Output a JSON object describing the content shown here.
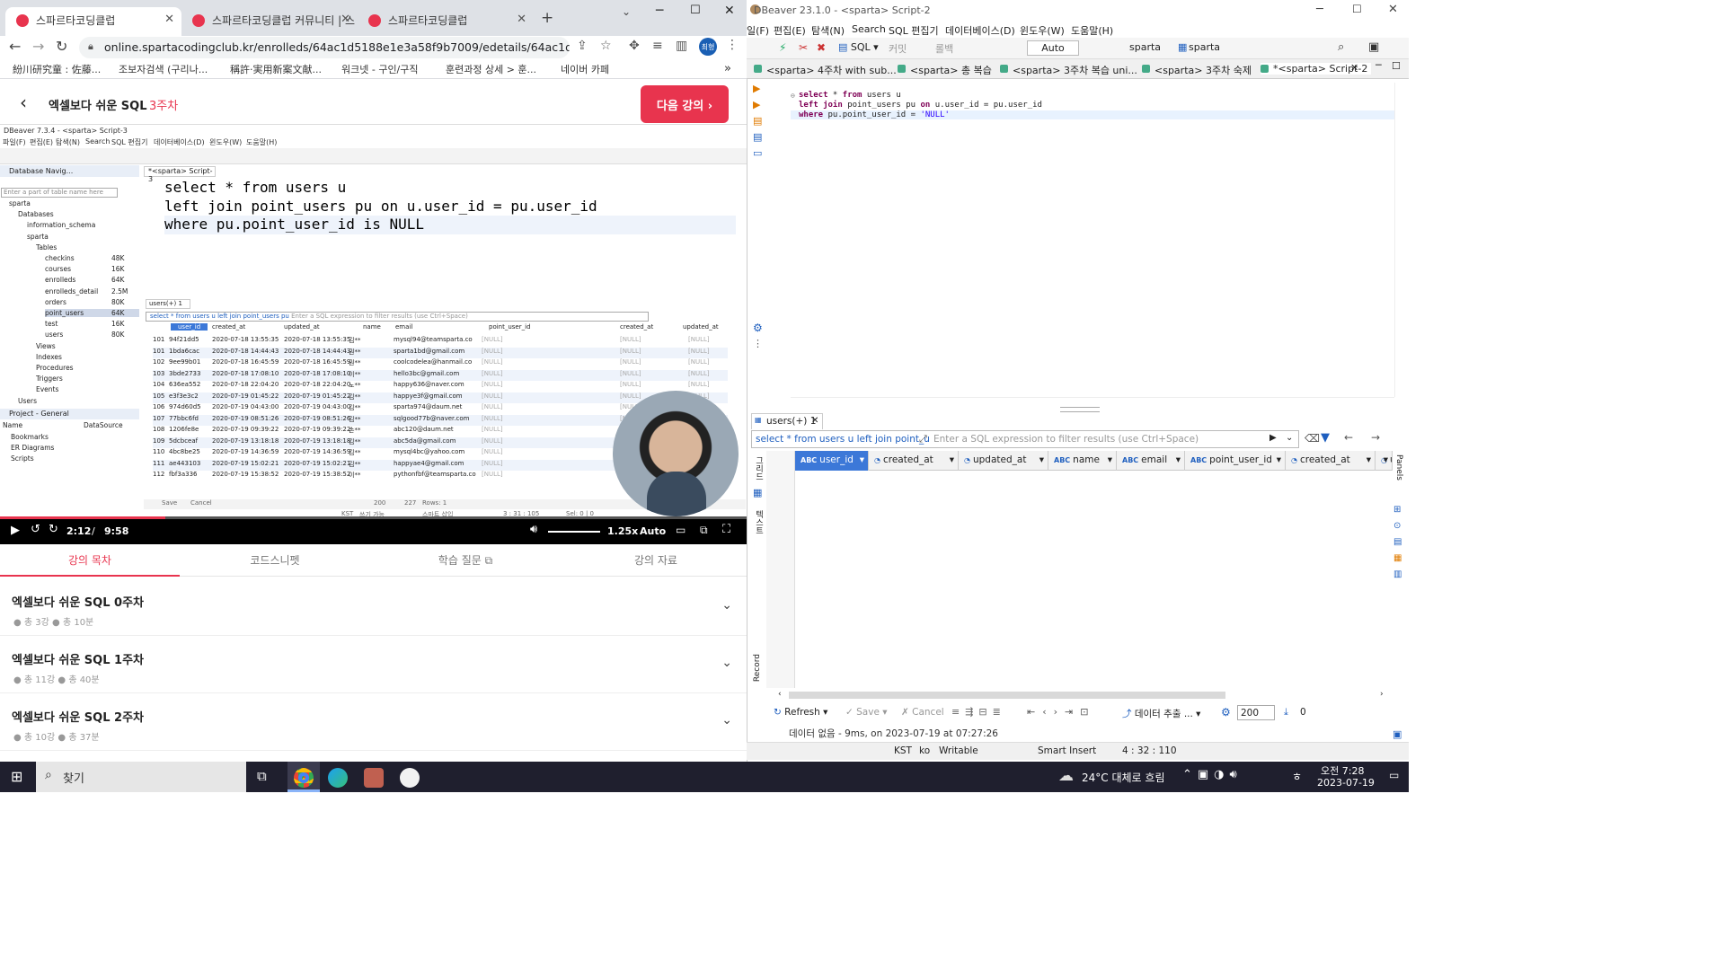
{
  "chrome": {
    "tabs": [
      {
        "title": "스파르타코딩클럽",
        "active": true
      },
      {
        "title": "스파르타코딩클럽 커뮤니티 | 스",
        "active": false
      },
      {
        "title": "스파르타코딩클럽",
        "active": false
      }
    ],
    "url": "online.spartacodingclub.kr/enrolleds/64ac1d5188e1e3a58f9b7009/edetails/64ac1d5188e1e3a58f9...",
    "profile_initials": "최형",
    "bookmarks": [
      "紛川研究童 : 佐藤...",
      "조보자검색 (구리나...",
      "稱許·実用新案文献...",
      "워크넷 - 구인/구직",
      "훈련과정 상세 > 훈...",
      "네이버 카페"
    ]
  },
  "lecture": {
    "title": "엑셀보다 쉬운 SQL",
    "week_label": "3주차",
    "next_button": "다음 강의",
    "tabs": [
      "강의 목차",
      "코드스니펫",
      "학습 질문",
      "강의 자료"
    ],
    "weeks": [
      {
        "title": "엑셀보다 쉬운 SQL 0주차",
        "lessons": "총 3강",
        "time": "총 10분"
      },
      {
        "title": "엑셀보다 쉬운 SQL 1주차",
        "lessons": "총 11강",
        "time": "총 40분"
      },
      {
        "title": "엑셀보다 쉬운 SQL 2주차",
        "lessons": "총 10강",
        "time": "총 37분"
      }
    ]
  },
  "video": {
    "current_time": "2:12",
    "separator": "/",
    "duration": "9:58",
    "progress": 0.221,
    "speed": "1.25x",
    "quality": "Auto",
    "inner": {
      "title": "DBeaver 7.3.4 - <sparta> Script-3",
      "menu": [
        "파일(F)",
        "편집(E)",
        "탐색(N)",
        "Search",
        "SQL 편집기",
        "데이터베이스(D)",
        "윈도우(W)",
        "도움말(H)"
      ],
      "nav_title": "Database Navig...",
      "project_title": "Project - General",
      "script_tab": "*<sparta> Script-3",
      "filter_placeholder": "Enter a part of table name here",
      "tree": [
        "sparta",
        "Databases",
        "information_schema",
        "sparta",
        "Tables",
        "checkins",
        "courses",
        "enrolleds",
        "enrolleds_detail",
        "orders",
        "point_users",
        "test",
        "users",
        "Views",
        "Indexes",
        "Procedures",
        "Triggers",
        "Events",
        "Users"
      ],
      "sizes": [
        "48K",
        "16K",
        "64K",
        "2.5M",
        "80K",
        "64K",
        "16K",
        "80K"
      ],
      "project_cols": [
        "Name",
        "DataSource"
      ],
      "project_items": [
        "Bookmarks",
        "ER Diagrams",
        "Scripts"
      ],
      "sql": [
        "select * from users u",
        "left join point_users pu on u.user_id = pu.user_id",
        "where pu.point_user_id is NULL"
      ],
      "result_tab": "users(+) 1",
      "result_filter": "select * from users u left join point_users pu",
      "result_filter_hint": "Enter a SQL expression to filter results (use Ctrl+Space)",
      "columns": [
        "user_id",
        "created_at",
        "updated_at",
        "name",
        "email",
        "point_user_id",
        "created_at",
        "updated_at"
      ],
      "rows": [
        [
          "101",
          "94f21dd5",
          "2020-07-18 13:55:35",
          "2020-07-18 13:55:35",
          "김**",
          "mysql94@teamsparta.co",
          "[NULL]",
          "[NULL]",
          "[NULL]"
        ],
        [
          "101",
          "1bda6cac",
          "2020-07-18 14:44:43",
          "2020-07-18 14:44:43",
          "권**",
          "sparta1bd@gmail.com",
          "[NULL]",
          "[NULL]",
          "[NULL]"
        ],
        [
          "102",
          "9ee99b01",
          "2020-07-18 16:45:59",
          "2020-07-18 16:45:59",
          "권**",
          "coolcodelea@hanmail.co",
          "[NULL]",
          "[NULL]",
          "[NULL]"
        ],
        [
          "103",
          "3bde2733",
          "2020-07-18 17:08:10",
          "2020-07-18 17:08:10",
          "이**",
          "hello3bc@gmail.com",
          "[NULL]",
          "[NULL]",
          "[NULL]"
        ],
        [
          "104",
          "636ea552",
          "2020-07-18 22:04:20",
          "2020-07-18 22:04:20",
          "노**",
          "happy636@naver.com",
          "[NULL]",
          "[NULL]",
          "[NULL]"
        ],
        [
          "105",
          "e3f3e3c2",
          "2020-07-19 01:45:22",
          "2020-07-19 01:45:22",
          "김**",
          "happye3f@gmail.com",
          "[NULL]",
          "[NULL]",
          "[NULL]"
        ],
        [
          "106",
          "974d60d5",
          "2020-07-19 04:43:00",
          "2020-07-19 04:43:00",
          "김**",
          "sparta974@daum.net",
          "[NULL]",
          "[NULL]",
          "[NULL]"
        ],
        [
          "107",
          "77bbc6fd",
          "2020-07-19 08:51:26",
          "2020-07-19 08:51:26",
          "김**",
          "sqlgood77b@naver.com",
          "[NULL]",
          "[NULL]",
          "[NULL]"
        ],
        [
          "108",
          "1206fe8e",
          "2020-07-19 09:39:22",
          "2020-07-19 09:39:22",
          "손**",
          "abc120@daum.net",
          "[NULL]",
          "[NULL]",
          "[NULL]"
        ],
        [
          "109",
          "5dcbceaf",
          "2020-07-19 13:18:18",
          "2020-07-19 13:18:18",
          "김**",
          "abc5da@gmail.com",
          "[NULL]",
          "[NULL]",
          "[NULL]"
        ],
        [
          "110",
          "4bc8be25",
          "2020-07-19 14:36:59",
          "2020-07-19 14:36:59",
          "김**",
          "mysql4bc@yahoo.com",
          "[NULL]",
          "[NULL]",
          "[NULL]"
        ],
        [
          "111",
          "ae443103",
          "2020-07-19 15:02:21",
          "2020-07-19 15:02:21",
          "김**",
          "happyae4@gmail.com",
          "[NULL]",
          "[NULL]",
          "[NULL]"
        ],
        [
          "112",
          "fbf3a336",
          "2020-07-19 15:38:52",
          "2020-07-19 15:38:52",
          "이**",
          "pythonfbf@teamsparta.co",
          "[NULL]",
          "[NULL]",
          "[NULL]"
        ]
      ],
      "status": {
        "save": "Save",
        "cancel": "Cancel",
        "limit": "200",
        "count": "227",
        "rows": "Rows: 1",
        "kst": "KST",
        "mode": "쓰기 가능",
        "insert": "스마트 삽입",
        "pos": "3 : 31 : 105",
        "sel": "Sel: 0 | 0"
      }
    }
  },
  "dbeaver": {
    "title": "DBeaver 23.1.0 - <sparta> Script-2",
    "menu": [
      "일(F)",
      "편집(E)",
      "탐색(N)",
      "Search",
      "SQL 편집기",
      "데이터베이스(D)",
      "윈도우(W)",
      "도움말(H)"
    ],
    "toolbar": {
      "sql": "SQL",
      "commit": "커밋",
      "rollback": "롤백",
      "auto": "Auto",
      "datasource": "sparta",
      "schema": "sparta"
    },
    "tabs": [
      "<sparta> 4주차 with sub...",
      "<sparta> 총 복습",
      "<sparta> 3주차 복습 uni...",
      "<sparta> 3주차 숙제",
      "*<sparta> Script-2"
    ],
    "sql": {
      "line1_kw1": "select",
      "line1_rest": " * ",
      "line1_kw2": "from",
      "line1_tail": " users u",
      "line2_kw1": "left join",
      "line2_mid": " point_users pu ",
      "line2_kw2": "on",
      "line2_tail": " u.user_id = pu.user_id",
      "line3_kw1": "where",
      "line3_mid": " pu.point_user_id = ",
      "line3_str": "'NULL'"
    },
    "result_tab": "users(+) 1",
    "filter_query": "select * from users u left join point_u",
    "filter_hint": "Enter a SQL expression to filter results (use Ctrl+Space)",
    "columns": [
      {
        "type": "ABC",
        "name": "user_id"
      },
      {
        "type": "◔",
        "name": "created_at"
      },
      {
        "type": "◔",
        "name": "updated_at"
      },
      {
        "type": "ABC",
        "name": "name"
      },
      {
        "type": "ABC",
        "name": "email"
      },
      {
        "type": "ABC",
        "name": "point_user_id"
      },
      {
        "type": "◔",
        "name": "created_at"
      },
      {
        "type": "◔",
        "name": "u"
      }
    ],
    "side_labels": {
      "grid": "그리드",
      "text": "텍스트",
      "record": "Record",
      "panels": "Panels"
    },
    "bottom": {
      "refresh": "Refresh",
      "save": "Save",
      "cancel": "Cancel",
      "export": "데이터 추출 ...",
      "limit": "200",
      "count": "0"
    },
    "status_message": "데이터 없음 - 9ms, on 2023-07-19 at 07:27:26",
    "statusbar": {
      "tz": "KST",
      "lang": "ko",
      "mode": "Writable",
      "insert": "Smart Insert",
      "pos": "4 : 32 : 110"
    }
  },
  "taskbar": {
    "search": "찾기",
    "weather": "24°C 대체로 흐림",
    "time": "오전 7:28",
    "date": "2023-07-19",
    "ime": "ㅎ"
  },
  "colors": {
    "brand": "#e8344e",
    "taskbar": "#1f1f2e",
    "selected": "#3c78d8"
  }
}
